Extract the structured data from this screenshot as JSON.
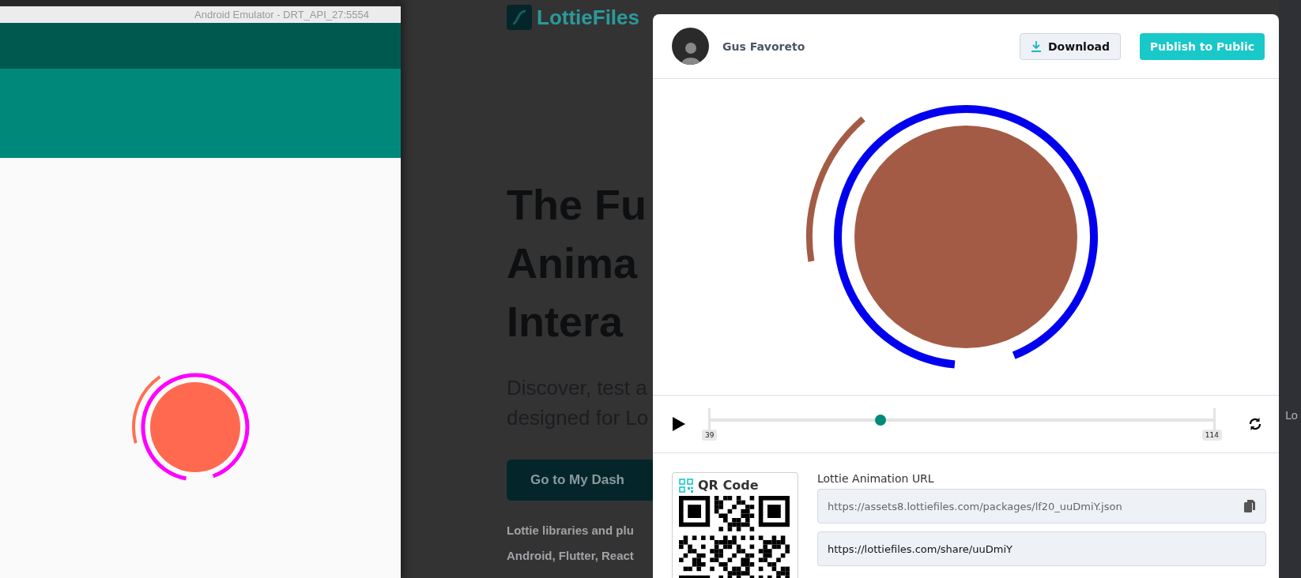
{
  "emulator": {
    "title": "Android Emulator - DRT_API_27:5554"
  },
  "background_page": {
    "logo": "LottieFiles",
    "headline": [
      "The Fu",
      "Anima",
      "Intera"
    ],
    "subtitle": [
      "Discover, test a",
      "designed for Lo"
    ],
    "cta": "Go to My Dash",
    "body": [
      "Lottie libraries and plu",
      "Android, Flutter, React"
    ],
    "edge_text": "Lo"
  },
  "modal": {
    "author": "Gus Favoreto",
    "buttons": [
      {
        "label": "Download",
        "kind": "secondary"
      },
      {
        "label": "Publish to Public",
        "kind": "primary"
      }
    ],
    "player": {
      "playing": false,
      "level": 0.34,
      "start": "39",
      "end": "114"
    },
    "qr": {
      "title": "QR Code"
    },
    "url_label": "Lottie Animation URL",
    "fields": [
      {
        "value": "https://assets8.lottiefiles.com/packages/lf20_uuDmiY.json",
        "kind": "copy"
      },
      {
        "value": "https://lottiefiles.com/share/uuDmiY",
        "kind": "plain"
      }
    ]
  }
}
